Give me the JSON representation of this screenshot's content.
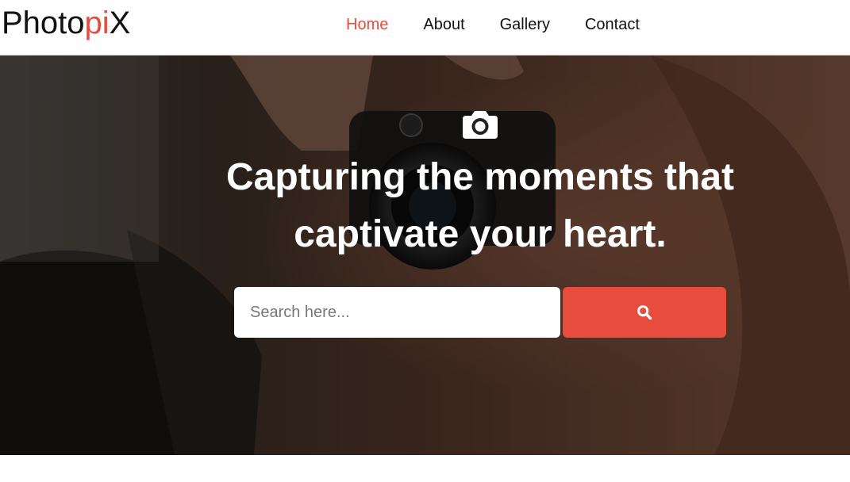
{
  "brand": {
    "name_part1": "Photo",
    "name_accent": "pi",
    "name_part2": "X",
    "accent_color": "#e74c3c"
  },
  "nav": {
    "items": [
      {
        "label": "Home",
        "active": true
      },
      {
        "label": "About",
        "active": false
      },
      {
        "label": "Gallery",
        "active": false
      },
      {
        "label": "Contact",
        "active": false
      }
    ]
  },
  "hero": {
    "icon": "camera-icon",
    "headline_line1": "Capturing the moments that",
    "headline_line2": "captivate your heart.",
    "search_placeholder": "Search here...",
    "search_button_icon": "search-icon"
  }
}
